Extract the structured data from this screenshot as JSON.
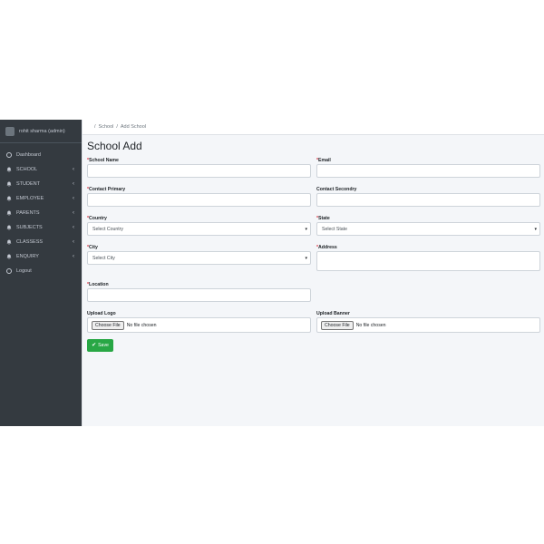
{
  "sidebar": {
    "user_name": "rohit sharma (admin)",
    "items": [
      {
        "label": "Dashboard",
        "icon": "circle-icon",
        "has_chevron": false
      },
      {
        "label": "SCHOOL",
        "icon": "bell-icon",
        "has_chevron": true
      },
      {
        "label": "STUDENT",
        "icon": "bell-icon",
        "has_chevron": true
      },
      {
        "label": "EMPLOYEE",
        "icon": "bell-icon",
        "has_chevron": true
      },
      {
        "label": "PARENTS",
        "icon": "bell-icon",
        "has_chevron": true
      },
      {
        "label": "SUBJECTS",
        "icon": "bell-icon",
        "has_chevron": true
      },
      {
        "label": "CLASSESS",
        "icon": "bell-icon",
        "has_chevron": true
      },
      {
        "label": "ENQUIRY",
        "icon": "bell-icon",
        "has_chevron": true
      },
      {
        "label": "Logout",
        "icon": "circle-icon",
        "has_chevron": false
      }
    ],
    "chevron": "‹"
  },
  "breadcrumb": {
    "sep": "/",
    "items": [
      "School",
      "Add School"
    ]
  },
  "page": {
    "title": "School Add"
  },
  "form": {
    "required_mark": "*",
    "school_name": {
      "label": "School Name",
      "value": ""
    },
    "email": {
      "label": "Email",
      "value": ""
    },
    "contact_primary": {
      "label": "Contact Primary",
      "value": ""
    },
    "contact_secondary": {
      "label": "Contact Secondry",
      "value": ""
    },
    "country": {
      "label": "Country",
      "selected": "Select Country"
    },
    "state": {
      "label": "State",
      "selected": "Select State"
    },
    "city": {
      "label": "City",
      "selected": "Select City"
    },
    "address": {
      "label": "Address",
      "value": ""
    },
    "location": {
      "label": "Location",
      "value": ""
    },
    "upload_logo": {
      "label": "Upload Logo",
      "button": "Choose File",
      "status": "No file chosen"
    },
    "upload_banner": {
      "label": "Upload Banner",
      "button": "Choose File",
      "status": "No file chosen"
    },
    "save_label": "Save",
    "caret": "▾"
  },
  "colors": {
    "sidebar_bg": "#343a40",
    "main_bg": "#f4f6f9",
    "save_green": "#28a745",
    "required_red": "#dc3545"
  }
}
